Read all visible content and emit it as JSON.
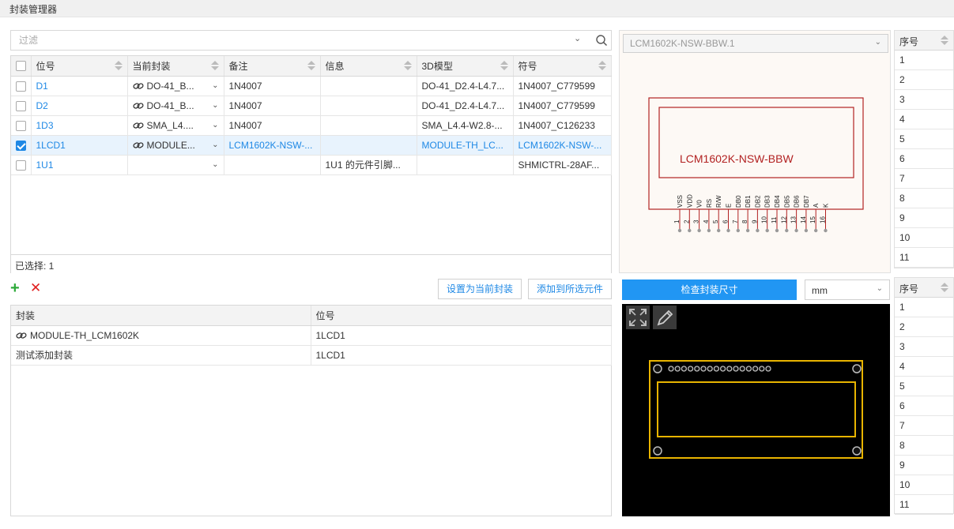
{
  "window": {
    "title": "封装管理器"
  },
  "filter": {
    "placeholder": "过滤"
  },
  "components_table": {
    "headers": [
      "位号",
      "当前封装",
      "备注",
      "信息",
      "3D模型",
      "符号"
    ],
    "rows": [
      {
        "checked": false,
        "designator": "D1",
        "footprint": "DO-41_B...",
        "note": "1N4007",
        "info": "",
        "model3d": "DO-41_D2.4-L4.7...",
        "symbol": "1N4007_C779599"
      },
      {
        "checked": false,
        "designator": "D2",
        "footprint": "DO-41_B...",
        "note": "1N4007",
        "info": "",
        "model3d": "DO-41_D2.4-L4.7...",
        "symbol": "1N4007_C779599"
      },
      {
        "checked": false,
        "designator": "1D3",
        "footprint": "SMA_L4....",
        "note": "1N4007",
        "info": "",
        "model3d": "SMA_L4.4-W2.8-...",
        "symbol": "1N4007_C126233"
      },
      {
        "checked": true,
        "designator": "1LCD1",
        "footprint": "MODULE...",
        "note": "LCM1602K-NSW-...",
        "info": "",
        "model3d": "MODULE-TH_LC...",
        "symbol": "LCM1602K-NSW-..."
      },
      {
        "checked": false,
        "designator": "1U1",
        "footprint": "",
        "note": "",
        "info": "1U1 的元件引脚...",
        "model3d": "",
        "symbol": "SHMICTRL-28AF..."
      }
    ],
    "selected_label": "已选择:  1"
  },
  "actions": {
    "set_current": "设置为当前封装",
    "add_to_selected": "添加到所选元件"
  },
  "footprint_table": {
    "headers": [
      "封装",
      "位号"
    ],
    "rows": [
      {
        "name": "MODULE-TH_LCM1602K",
        "designator": "1LCD1",
        "linked": true
      },
      {
        "name": "测试添加封装",
        "designator": "1LCD1",
        "linked": false
      }
    ]
  },
  "symbol_preview": {
    "selector": "LCM1602K-NSW-BBW.1",
    "part_name": "LCM1602K-NSW-BBW",
    "pins": [
      {
        "num": "1",
        "name": "VSS"
      },
      {
        "num": "2",
        "name": "VDD"
      },
      {
        "num": "3",
        "name": "V0"
      },
      {
        "num": "4",
        "name": "RS"
      },
      {
        "num": "5",
        "name": "R/W"
      },
      {
        "num": "6",
        "name": "E"
      },
      {
        "num": "7",
        "name": "DB0"
      },
      {
        "num": "8",
        "name": "DB1"
      },
      {
        "num": "9",
        "name": "DB2"
      },
      {
        "num": "10",
        "name": "DB3"
      },
      {
        "num": "11",
        "name": "DB4"
      },
      {
        "num": "12",
        "name": "DB5"
      },
      {
        "num": "13",
        "name": "DB6"
      },
      {
        "num": "14",
        "name": "DB7"
      },
      {
        "num": "15",
        "name": "A"
      },
      {
        "num": "16",
        "name": "K"
      }
    ]
  },
  "seq_top": {
    "header": "序号",
    "rows": [
      "1",
      "2",
      "3",
      "4",
      "5",
      "6",
      "7",
      "8",
      "9",
      "10",
      "11"
    ]
  },
  "seq_bottom": {
    "header": "序号",
    "rows": [
      "1",
      "2",
      "3",
      "4",
      "5",
      "6",
      "7",
      "8",
      "9",
      "10",
      "11"
    ]
  },
  "footprint_preview": {
    "check_button": "检查封装尺寸",
    "unit": "mm"
  },
  "colors": {
    "accent": "#1e88e5",
    "symbol_line": "#b22222",
    "pcb_outline": "#e8b400"
  }
}
